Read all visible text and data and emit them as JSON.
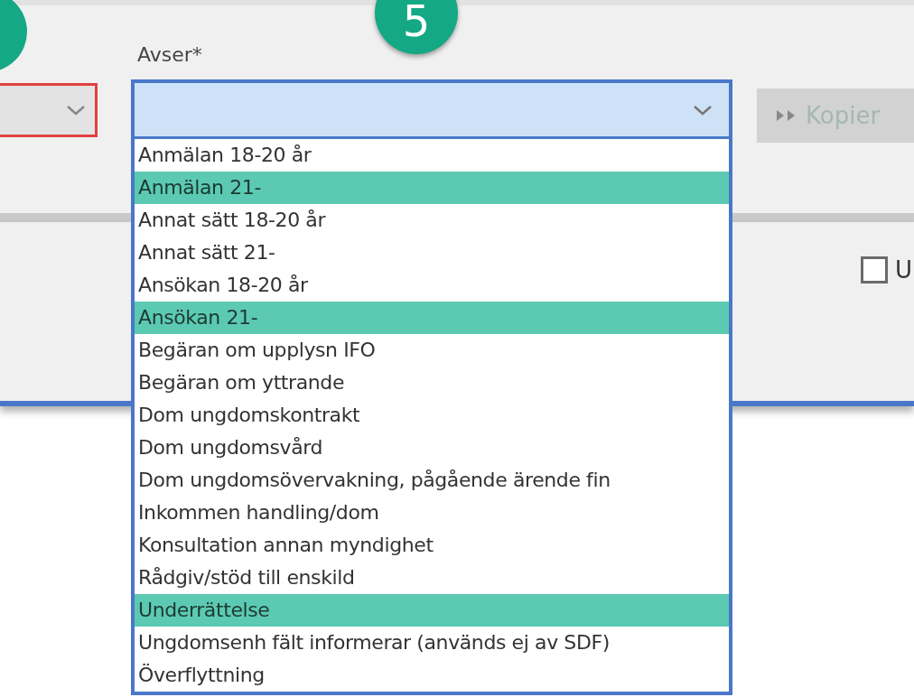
{
  "step_badge": {
    "label": "5"
  },
  "left_combo": {
    "invalid": true
  },
  "avser": {
    "label": "Avser*",
    "expanded": true,
    "options": [
      {
        "label": "Anmälan 18-20 år",
        "highlighted": false
      },
      {
        "label": "Anmälan 21-",
        "highlighted": true
      },
      {
        "label": "Annat sätt 18-20 år",
        "highlighted": false
      },
      {
        "label": "Annat sätt 21-",
        "highlighted": false
      },
      {
        "label": "Ansökan 18-20 år",
        "highlighted": false
      },
      {
        "label": "Ansökan 21-",
        "highlighted": true
      },
      {
        "label": "Begäran om upplysn IFO",
        "highlighted": false
      },
      {
        "label": "Begäran om yttrande",
        "highlighted": false
      },
      {
        "label": "Dom ungdomskontrakt",
        "highlighted": false
      },
      {
        "label": "Dom ungdomsvård",
        "highlighted": false
      },
      {
        "label": "Dom ungdomsövervakning, pågående ärende fin",
        "highlighted": false
      },
      {
        "label": "Inkommen handling/dom",
        "highlighted": false
      },
      {
        "label": "Konsultation annan myndighet",
        "highlighted": false
      },
      {
        "label": "Rådgiv/stöd till enskild",
        "highlighted": false
      },
      {
        "label": "Underrättelse",
        "highlighted": true
      },
      {
        "label": "Ungdomsenh fält informerar (används ej av SDF)",
        "highlighted": false
      },
      {
        "label": "Överflyttning",
        "highlighted": false
      }
    ]
  },
  "copy_button": {
    "label": "Kopier",
    "disabled": true
  },
  "checkbox": {
    "label": "U",
    "checked": false
  }
}
